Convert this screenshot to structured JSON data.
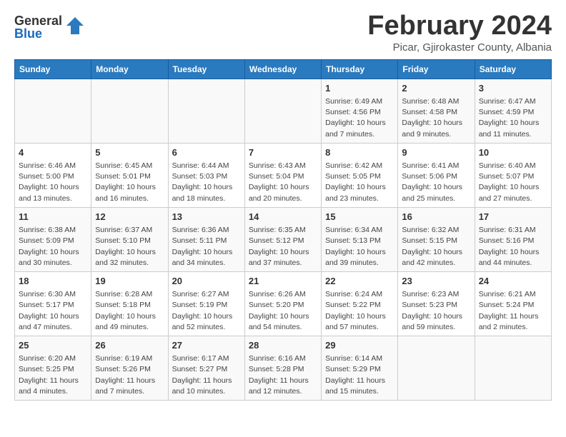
{
  "logo": {
    "general": "General",
    "blue": "Blue"
  },
  "header": {
    "month": "February 2024",
    "location": "Picar, Gjirokaster County, Albania"
  },
  "weekdays": [
    "Sunday",
    "Monday",
    "Tuesday",
    "Wednesday",
    "Thursday",
    "Friday",
    "Saturday"
  ],
  "weeks": [
    [
      {
        "day": "",
        "info": ""
      },
      {
        "day": "",
        "info": ""
      },
      {
        "day": "",
        "info": ""
      },
      {
        "day": "",
        "info": ""
      },
      {
        "day": "1",
        "info": "Sunrise: 6:49 AM\nSunset: 4:56 PM\nDaylight: 10 hours\nand 7 minutes."
      },
      {
        "day": "2",
        "info": "Sunrise: 6:48 AM\nSunset: 4:58 PM\nDaylight: 10 hours\nand 9 minutes."
      },
      {
        "day": "3",
        "info": "Sunrise: 6:47 AM\nSunset: 4:59 PM\nDaylight: 10 hours\nand 11 minutes."
      }
    ],
    [
      {
        "day": "4",
        "info": "Sunrise: 6:46 AM\nSunset: 5:00 PM\nDaylight: 10 hours\nand 13 minutes."
      },
      {
        "day": "5",
        "info": "Sunrise: 6:45 AM\nSunset: 5:01 PM\nDaylight: 10 hours\nand 16 minutes."
      },
      {
        "day": "6",
        "info": "Sunrise: 6:44 AM\nSunset: 5:03 PM\nDaylight: 10 hours\nand 18 minutes."
      },
      {
        "day": "7",
        "info": "Sunrise: 6:43 AM\nSunset: 5:04 PM\nDaylight: 10 hours\nand 20 minutes."
      },
      {
        "day": "8",
        "info": "Sunrise: 6:42 AM\nSunset: 5:05 PM\nDaylight: 10 hours\nand 23 minutes."
      },
      {
        "day": "9",
        "info": "Sunrise: 6:41 AM\nSunset: 5:06 PM\nDaylight: 10 hours\nand 25 minutes."
      },
      {
        "day": "10",
        "info": "Sunrise: 6:40 AM\nSunset: 5:07 PM\nDaylight: 10 hours\nand 27 minutes."
      }
    ],
    [
      {
        "day": "11",
        "info": "Sunrise: 6:38 AM\nSunset: 5:09 PM\nDaylight: 10 hours\nand 30 minutes."
      },
      {
        "day": "12",
        "info": "Sunrise: 6:37 AM\nSunset: 5:10 PM\nDaylight: 10 hours\nand 32 minutes."
      },
      {
        "day": "13",
        "info": "Sunrise: 6:36 AM\nSunset: 5:11 PM\nDaylight: 10 hours\nand 34 minutes."
      },
      {
        "day": "14",
        "info": "Sunrise: 6:35 AM\nSunset: 5:12 PM\nDaylight: 10 hours\nand 37 minutes."
      },
      {
        "day": "15",
        "info": "Sunrise: 6:34 AM\nSunset: 5:13 PM\nDaylight: 10 hours\nand 39 minutes."
      },
      {
        "day": "16",
        "info": "Sunrise: 6:32 AM\nSunset: 5:15 PM\nDaylight: 10 hours\nand 42 minutes."
      },
      {
        "day": "17",
        "info": "Sunrise: 6:31 AM\nSunset: 5:16 PM\nDaylight: 10 hours\nand 44 minutes."
      }
    ],
    [
      {
        "day": "18",
        "info": "Sunrise: 6:30 AM\nSunset: 5:17 PM\nDaylight: 10 hours\nand 47 minutes."
      },
      {
        "day": "19",
        "info": "Sunrise: 6:28 AM\nSunset: 5:18 PM\nDaylight: 10 hours\nand 49 minutes."
      },
      {
        "day": "20",
        "info": "Sunrise: 6:27 AM\nSunset: 5:19 PM\nDaylight: 10 hours\nand 52 minutes."
      },
      {
        "day": "21",
        "info": "Sunrise: 6:26 AM\nSunset: 5:20 PM\nDaylight: 10 hours\nand 54 minutes."
      },
      {
        "day": "22",
        "info": "Sunrise: 6:24 AM\nSunset: 5:22 PM\nDaylight: 10 hours\nand 57 minutes."
      },
      {
        "day": "23",
        "info": "Sunrise: 6:23 AM\nSunset: 5:23 PM\nDaylight: 10 hours\nand 59 minutes."
      },
      {
        "day": "24",
        "info": "Sunrise: 6:21 AM\nSunset: 5:24 PM\nDaylight: 11 hours\nand 2 minutes."
      }
    ],
    [
      {
        "day": "25",
        "info": "Sunrise: 6:20 AM\nSunset: 5:25 PM\nDaylight: 11 hours\nand 4 minutes."
      },
      {
        "day": "26",
        "info": "Sunrise: 6:19 AM\nSunset: 5:26 PM\nDaylight: 11 hours\nand 7 minutes."
      },
      {
        "day": "27",
        "info": "Sunrise: 6:17 AM\nSunset: 5:27 PM\nDaylight: 11 hours\nand 10 minutes."
      },
      {
        "day": "28",
        "info": "Sunrise: 6:16 AM\nSunset: 5:28 PM\nDaylight: 11 hours\nand 12 minutes."
      },
      {
        "day": "29",
        "info": "Sunrise: 6:14 AM\nSunset: 5:29 PM\nDaylight: 11 hours\nand 15 minutes."
      },
      {
        "day": "",
        "info": ""
      },
      {
        "day": "",
        "info": ""
      }
    ]
  ]
}
